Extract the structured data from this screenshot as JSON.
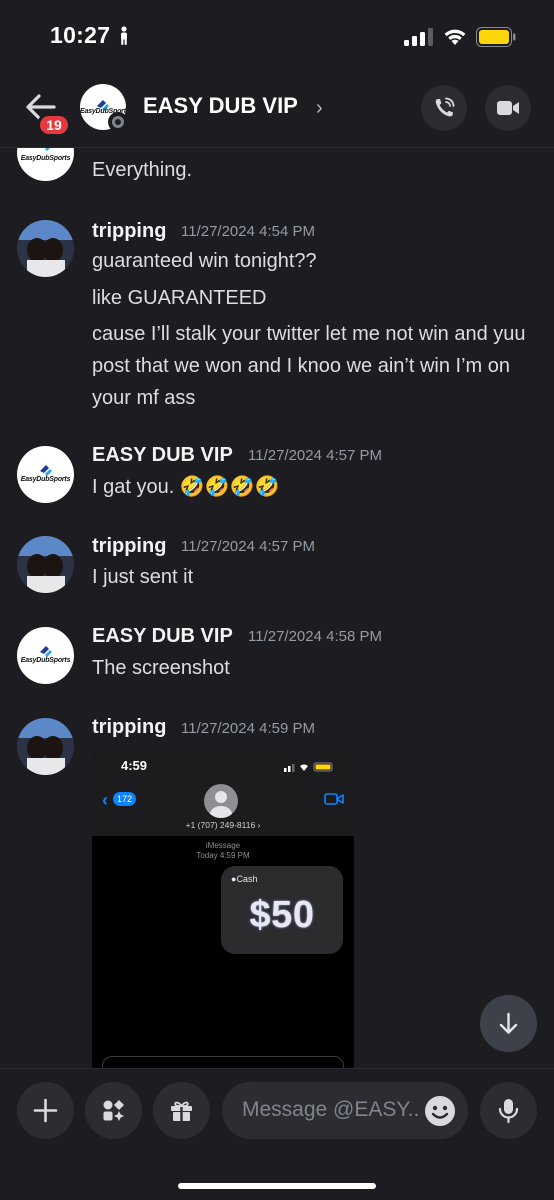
{
  "status_bar": {
    "time": "10:27",
    "battery_color": "#ffd60a"
  },
  "header": {
    "back_badge": "19",
    "channel_name": "EASY DUB VIP",
    "chevron": "›"
  },
  "avatar_logo_text": "EasyDubSports",
  "messages": [
    {
      "author": "",
      "time": "",
      "lines": [
        "Everything."
      ],
      "avatar": "logo"
    },
    {
      "author": "tripping",
      "time": "11/27/2024 4:54 PM",
      "lines": [
        "guaranteed win tonight??",
        "like GUARANTEED",
        "cause I’ll stalk your twitter let me not win and yuu post that we won and I knoo we ain’t win I’m on your mf ass"
      ],
      "avatar": "photo"
    },
    {
      "author": "EASY DUB VIP",
      "time": "11/27/2024 4:57 PM",
      "lines": [
        "I gat you. 🤣🤣🤣🤣"
      ],
      "avatar": "logo"
    },
    {
      "author": "tripping",
      "time": "11/27/2024 4:57 PM",
      "lines": [
        "I just sent it"
      ],
      "avatar": "photo"
    },
    {
      "author": "EASY DUB VIP",
      "time": "11/27/2024 4:58 PM",
      "lines": [
        "The screenshot"
      ],
      "avatar": "logo"
    },
    {
      "author": "tripping",
      "time": "11/27/2024 4:59 PM",
      "lines": [],
      "avatar": "photo"
    }
  ],
  "attachment": {
    "time": "4:59",
    "back_count": "172",
    "contact_number": "+1 (707) 249-8116 ›",
    "service": "iMessage",
    "service_time": "Today 4:59 PM",
    "cash_label": "Cash",
    "cash_amount": "$50"
  },
  "composer": {
    "placeholder": "Message @EASY..",
    "buttons": [
      "plus-icon",
      "apps-icon",
      "gift-icon",
      "microphone-icon"
    ]
  },
  "colors": {
    "background": "#1c1c21",
    "badge": "#e5393f",
    "link_blue": "#0a84ff"
  }
}
